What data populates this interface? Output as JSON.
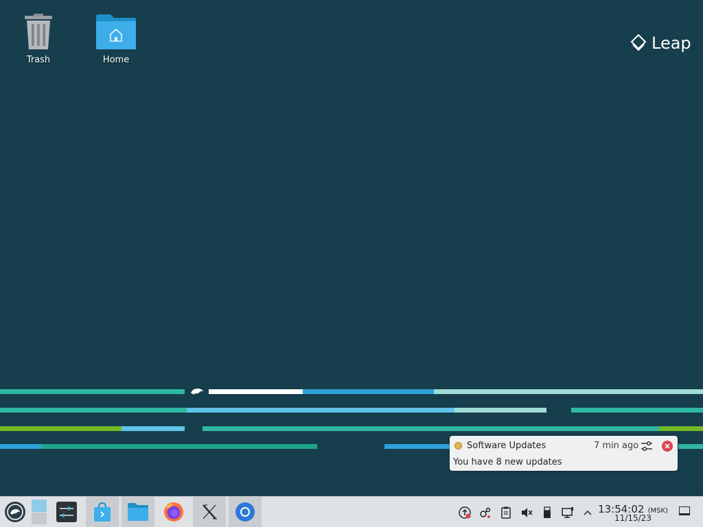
{
  "desktop": {
    "icons": [
      {
        "label": "Trash",
        "icon": "trash-icon"
      },
      {
        "label": "Home",
        "icon": "home-folder-icon"
      }
    ],
    "branding": {
      "text": "Leap",
      "icon": "leap-logo-icon"
    }
  },
  "notification": {
    "app": "Software Updates",
    "time": "7 min ago",
    "body": "You have 8 new updates",
    "icons": [
      "software-updates-icon",
      "configure-icon",
      "close-icon"
    ]
  },
  "taskbar": {
    "launchers": [
      {
        "name": "application-launcher",
        "icon": "opensuse-icon"
      },
      {
        "name": "pager",
        "icon": "virtual-desktop-icon"
      },
      {
        "name": "system-settings",
        "icon": "settings-sliders-icon"
      },
      {
        "name": "discover",
        "icon": "shopping-bag-icon"
      },
      {
        "name": "dolphin",
        "icon": "folder-icon"
      },
      {
        "name": "firefox",
        "icon": "firefox-icon"
      },
      {
        "name": "xterm",
        "icon": "x-icon"
      },
      {
        "name": "chromium",
        "icon": "chromium-icon"
      }
    ],
    "tray": [
      "update-icon",
      "network-icon",
      "clipboard-icon",
      "volume-muted-icon",
      "usb-icon",
      "display-icon",
      "expand-tray-icon"
    ],
    "clock": {
      "time": "13:54:02",
      "timezone": "(MSK)",
      "date": "11/15/23"
    }
  },
  "colors": {
    "desktop_bg": "#173e4c",
    "stripe_teal": "#2fb8a0",
    "stripe_blue": "#2ea1d8",
    "stripe_green": "#73ba25",
    "panel_bg": "#dfe2e5",
    "close_red": "#da4453"
  }
}
